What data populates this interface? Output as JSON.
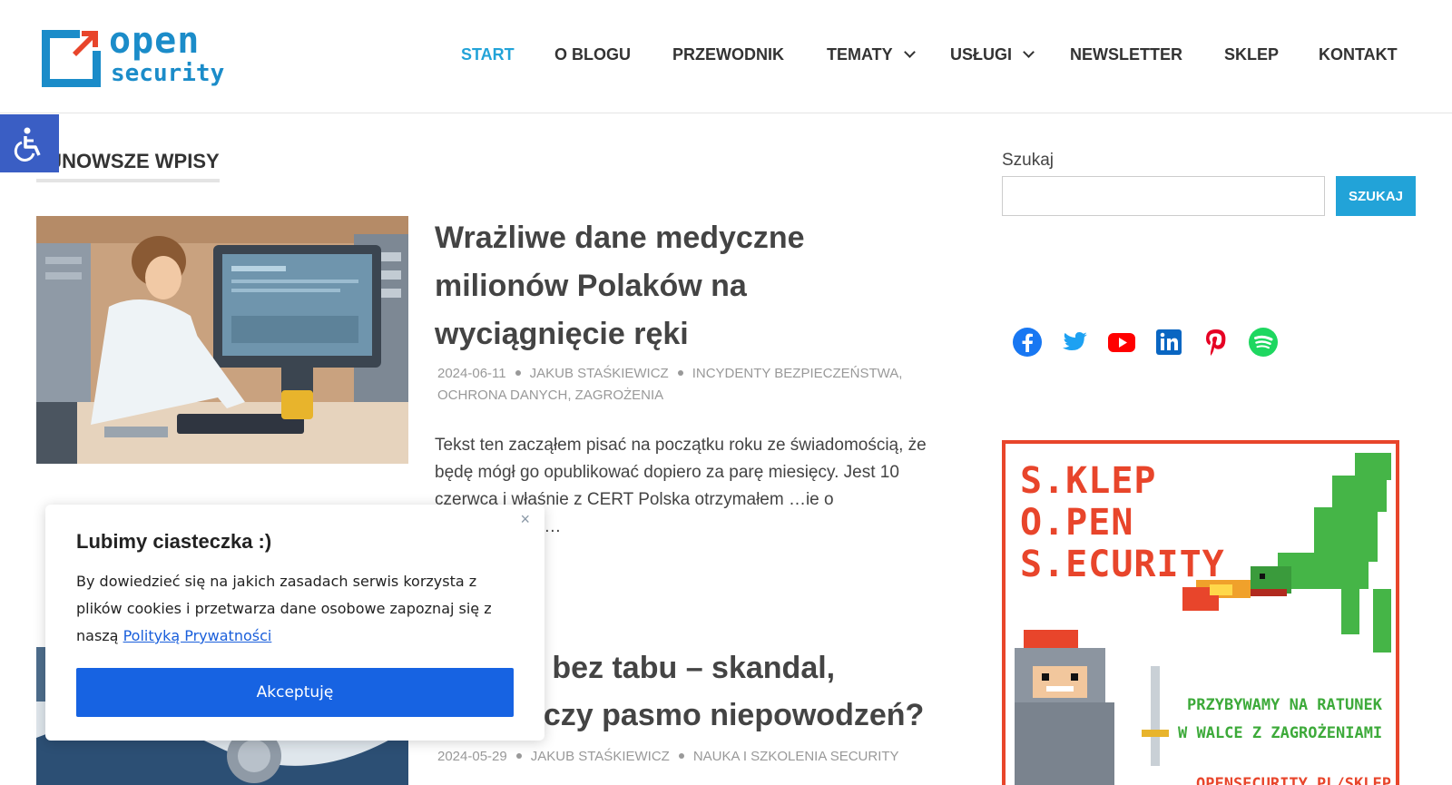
{
  "site": {
    "logo_line1": "open",
    "logo_line2": "security"
  },
  "nav": {
    "items": [
      {
        "label": "START",
        "active": true
      },
      {
        "label": "O BLOGU"
      },
      {
        "label": "PRZEWODNIK"
      },
      {
        "label": "TEMATY",
        "has_dropdown": true
      },
      {
        "label": "USŁUGI",
        "has_dropdown": true
      },
      {
        "label": "NEWSLETTER"
      },
      {
        "label": "SKLEP"
      },
      {
        "label": "KONTAKT"
      }
    ]
  },
  "main": {
    "section_title": "AJNOWSZE WPISY",
    "posts": [
      {
        "title": "Wrażliwe dane medyczne milionów Polaków na wyciągnięcie ręki",
        "date": "2024-06-11",
        "author": "JAKUB STAŚKIEWICZ",
        "categories_line1": "INCYDENTY BEZPIECZEŃSTWA,",
        "categories_line2": "OCHRONA DANYCH, ZAGROŻENIA",
        "excerpt": "Tekst ten zacząłem pisać na początku roku ze świadomością, że będę mógł go opublikować dopiero za parę miesięcy. Jest 10 czerwca i właśnie z CERT Polska otrzymałem …ie o upublicznieniu…"
      },
      {
        "title_line1": "y bez tabu – skandal,",
        "title_line2": ". czy pasmo niepowodzeń?",
        "date": "2024-05-29",
        "author": "JAKUB STAŚKIEWICZ",
        "categories": "NAUKA I SZKOLENIA SECURITY"
      }
    ]
  },
  "sidebar": {
    "search_label": "Szukaj",
    "search_value": "",
    "search_button": "SZUKAJ",
    "social": [
      "facebook-icon",
      "twitter-icon",
      "youtube-icon",
      "linkedin-icon",
      "pinterest-icon",
      "spotify-icon"
    ],
    "shop_banner": {
      "line1": "S.KLEP",
      "line2": "O.PEN",
      "line3": "S.ECURITY",
      "tag1": "PRZYBYWAMY NA RATUNEK",
      "tag2": "W WALCE Z ZAGROŻENIAMI",
      "url": "OPENSECURITY.PL/SKLEP"
    }
  },
  "cookie": {
    "title": "Lubimy ciasteczka :)",
    "text_before": "By dowiedzieć się na jakich zasadach serwis korzysta z plików cookies i przetwarza dane osobowe zapoznaj się z naszą ",
    "link": "Polityką Prywatności",
    "button": "Akceptuję",
    "close": "×"
  },
  "colors": {
    "accent": "#22a3d8",
    "logo": "#1b8cc9",
    "a11y": "#3a5ec4",
    "cookie_button": "#1763e2",
    "shop_red": "#e8452b",
    "shop_green": "#3daa3a"
  }
}
